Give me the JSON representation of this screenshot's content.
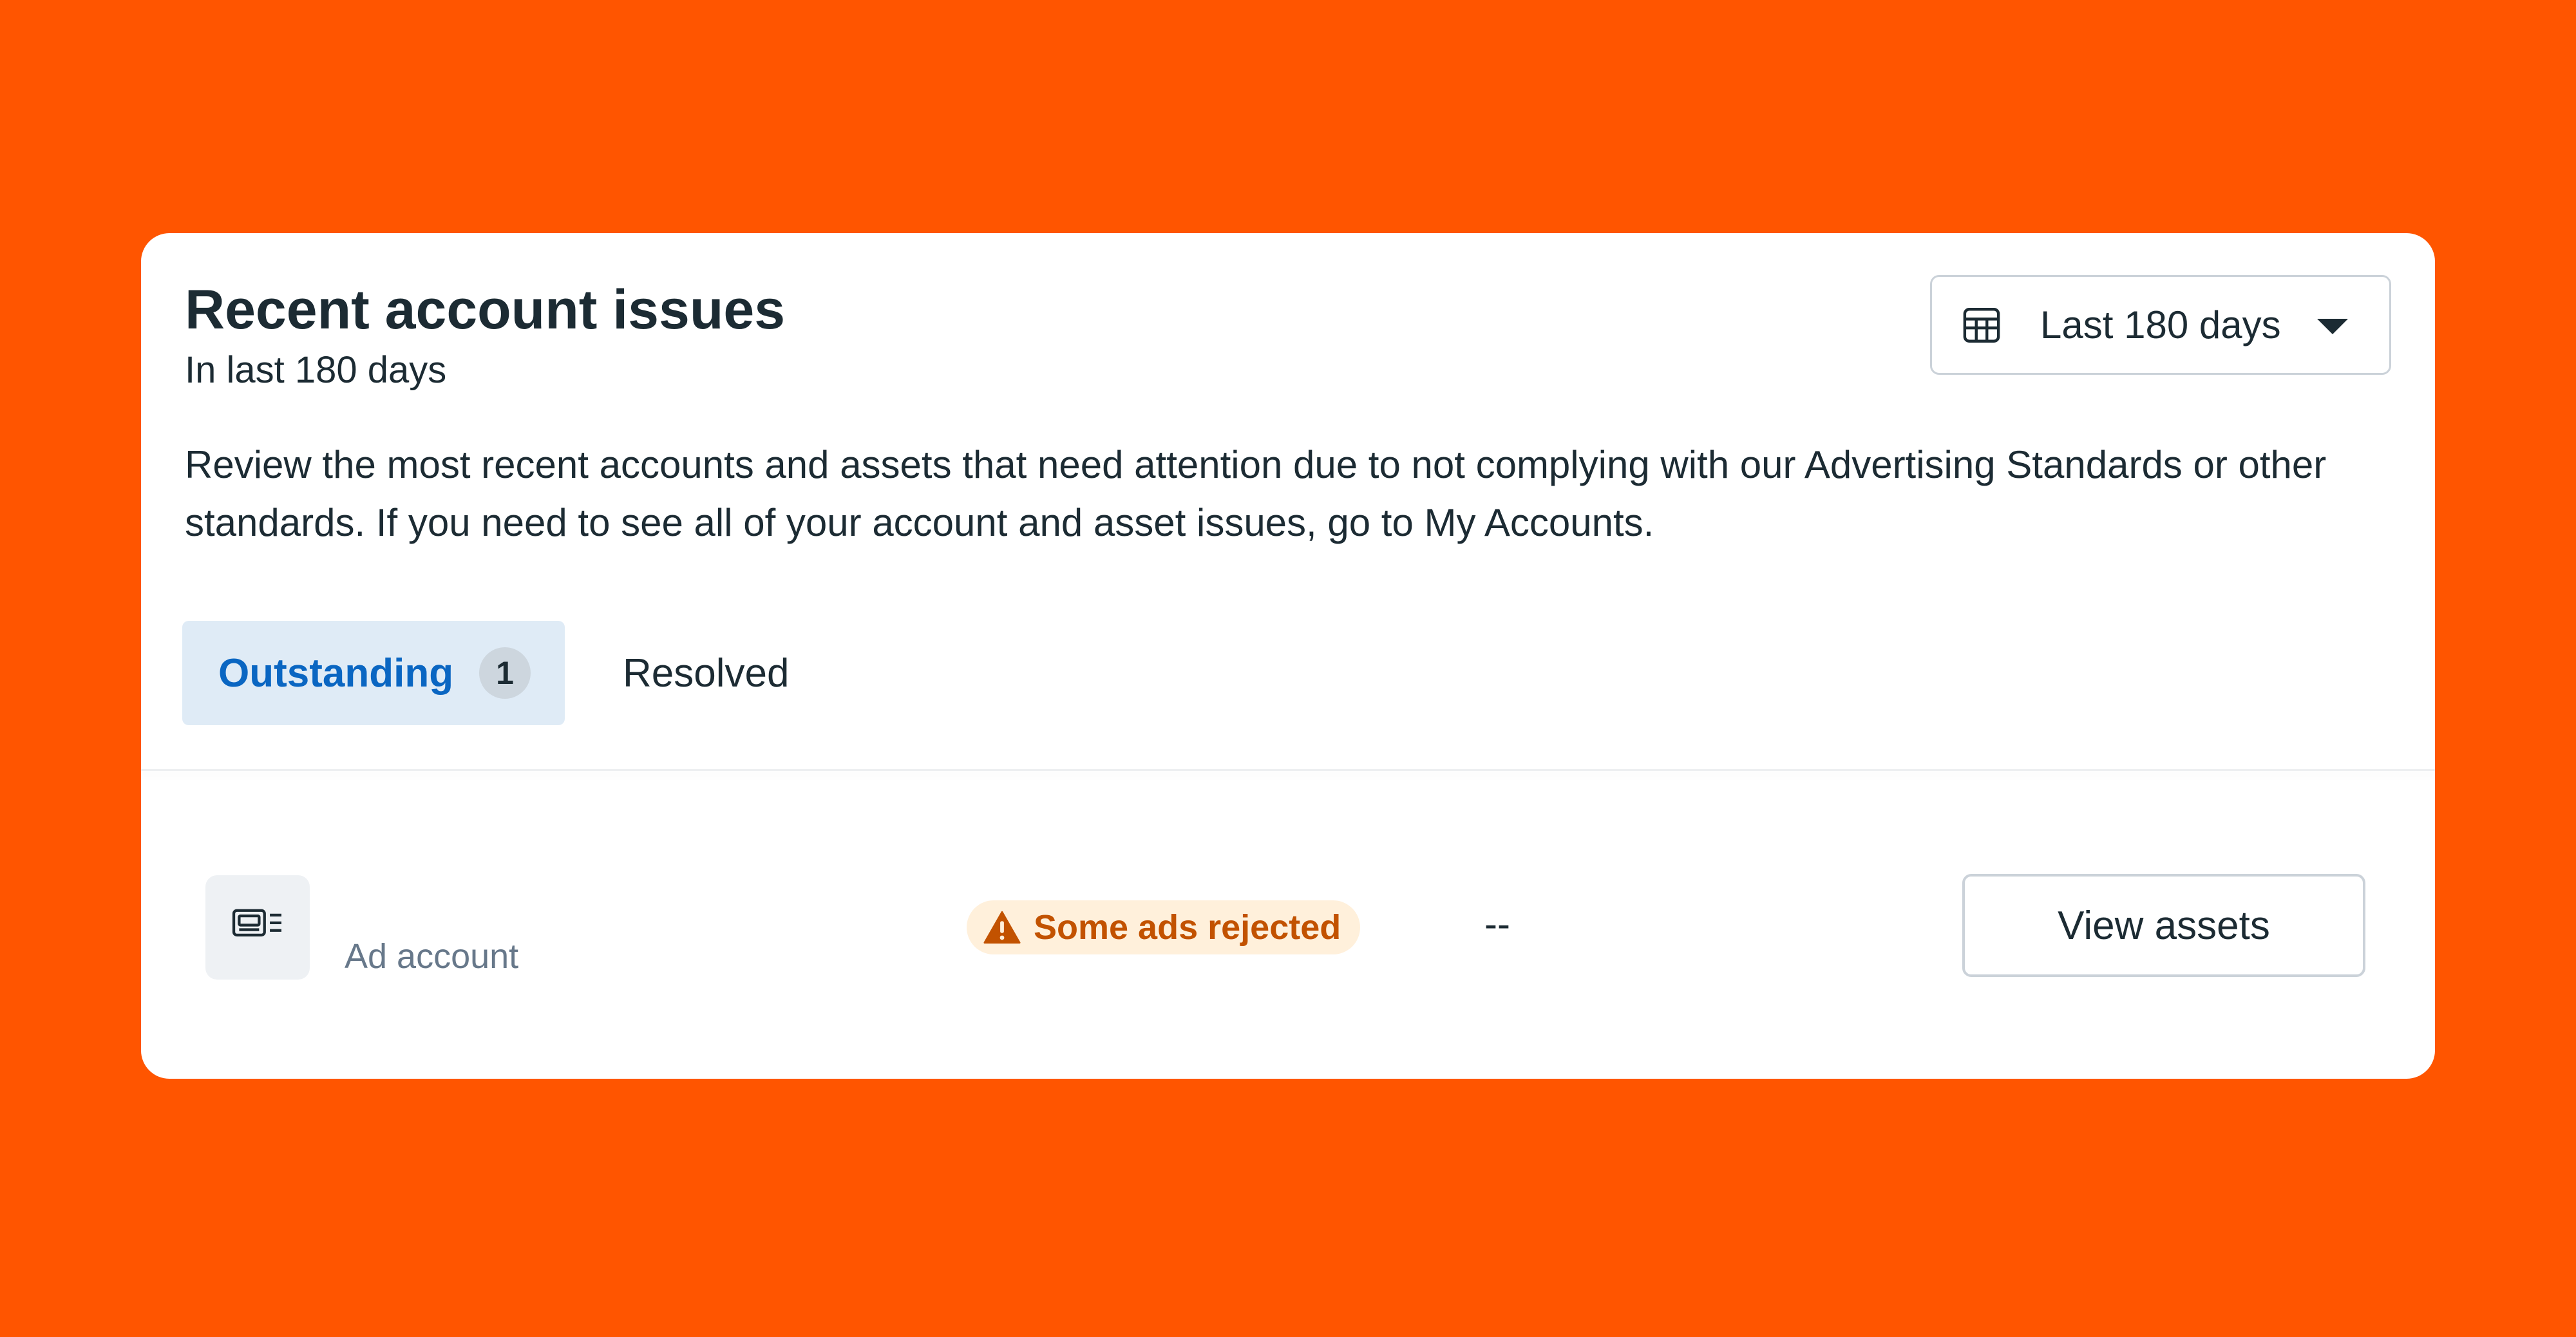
{
  "header": {
    "title": "Recent account issues",
    "subtitle": "In last 180 days",
    "date_range": {
      "icon": "calendar-icon",
      "label": "Last 180 days",
      "caret_icon": "caret-down-icon"
    }
  },
  "description": "Review the most recent accounts and assets that need attention due to not complying with our Advertising Standards or other standards. If you need to see all of your account and asset issues, go to My Accounts.",
  "tabs": [
    {
      "label": "Outstanding",
      "count": "1",
      "selected": true
    },
    {
      "label": "Resolved",
      "selected": false
    }
  ],
  "issues": [
    {
      "icon": "ad-account-icon",
      "asset_type": "Ad account",
      "status": {
        "icon": "warning-icon",
        "label": "Some ads rejected",
        "color": "#C25200",
        "background": "#FFF0DB"
      },
      "value": "--",
      "action_label": "View assets"
    }
  ],
  "colors": {
    "page_background": "#FF5500",
    "card_background": "#FFFFFF",
    "accent": "#0A66C2",
    "tab_selected_background": "#DFEBF6",
    "text_primary": "#1C2B33",
    "text_secondary": "#67788A"
  }
}
